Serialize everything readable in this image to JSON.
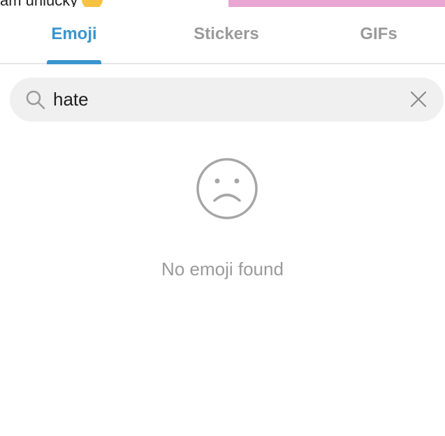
{
  "background_message": {
    "text": "am unlucky"
  },
  "tabs": [
    {
      "label": "Emoji",
      "active": true
    },
    {
      "label": "Stickers",
      "active": false
    },
    {
      "label": "GIFs",
      "active": false
    }
  ],
  "search": {
    "value": "hate",
    "icon": "search-icon",
    "clear_icon": "close-icon"
  },
  "empty_state": {
    "icon": "sad-face-icon",
    "message": "No emoji found"
  },
  "colors": {
    "accent": "#3a95cf",
    "inactive_tab": "#9a9a9a",
    "search_bg": "#f0f0f0",
    "empty_text": "#9a9a9a"
  }
}
